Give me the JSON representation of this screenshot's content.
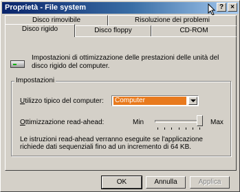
{
  "window": {
    "title": "Proprietà - File system",
    "help_glyph": "?",
    "close_glyph": "×"
  },
  "tabs": {
    "back_row": [
      "Disco rimovibile",
      "Risoluzione dei problemi"
    ],
    "front_row": [
      "Disco rigido",
      "Disco floppy",
      "CD-ROM"
    ],
    "active": "Disco rigido"
  },
  "description": "Impostazioni di ottimizzazione delle prestazioni delle unità del disco rigido del computer.",
  "settings": {
    "group_label": "Impostazioni",
    "usage_label": "Utilizzo tipico del computer:",
    "usage_value": "Computer",
    "readahead_label": "Ottimizzazione read-ahead:",
    "min_label": "Min",
    "max_label": "Max",
    "readahead_level": 1.0,
    "info": "Le istruzioni read-ahead verranno eseguite se l'applicazione richiede dati sequenziali fino ad un incremento di 64 KB."
  },
  "buttons": {
    "ok": "OK",
    "cancel": "Annulla",
    "apply": "Applica"
  },
  "colors": {
    "selection": "#e87a1e",
    "title_start": "#0a246a"
  }
}
